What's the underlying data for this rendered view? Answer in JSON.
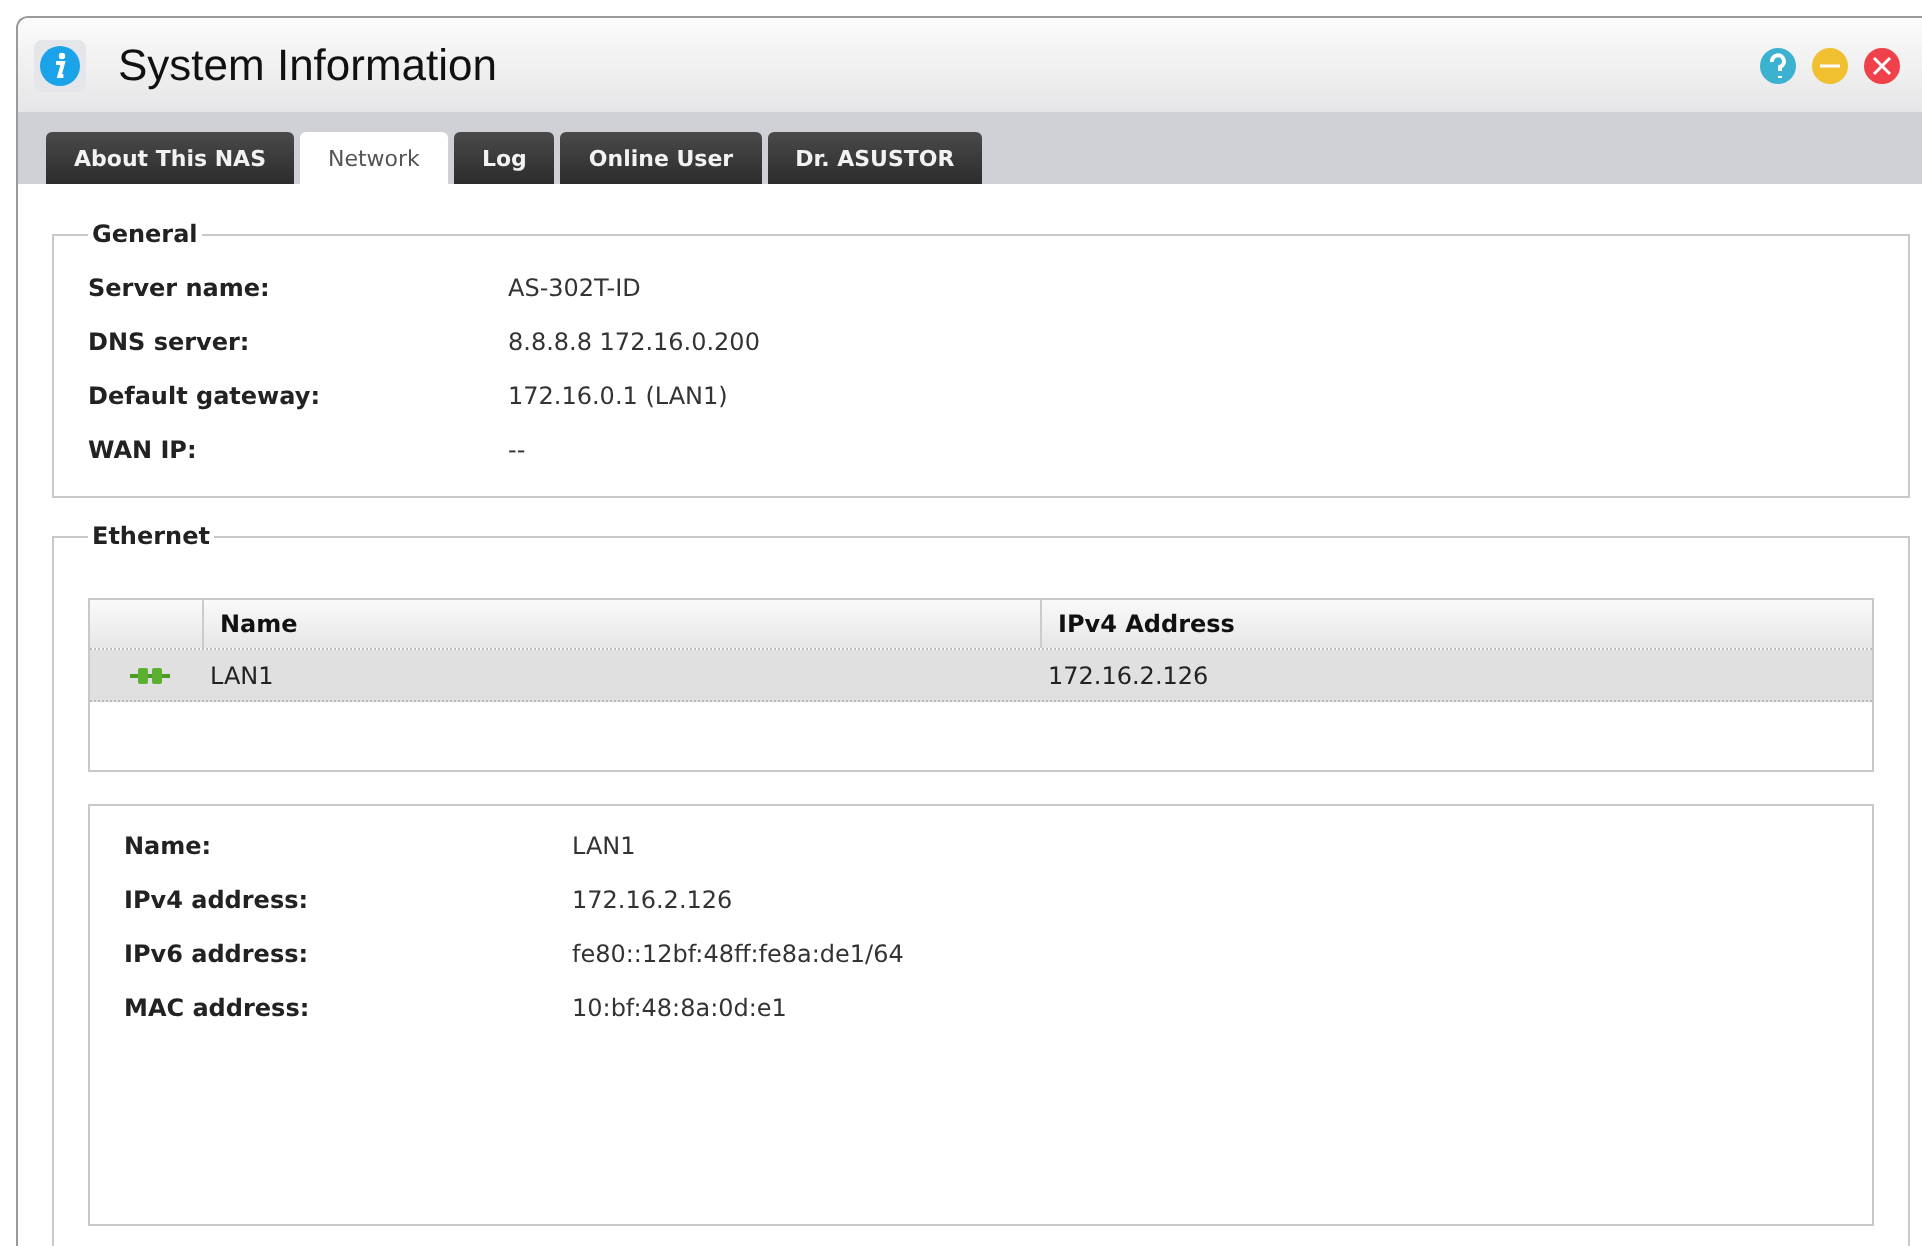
{
  "window": {
    "title": "System Information"
  },
  "tabs": [
    {
      "label": "About This NAS",
      "selected": false
    },
    {
      "label": "Network",
      "selected": true
    },
    {
      "label": "Log",
      "selected": false
    },
    {
      "label": "Online User",
      "selected": false
    },
    {
      "label": "Dr. ASUSTOR",
      "selected": false
    }
  ],
  "general": {
    "title": "General",
    "fields": [
      {
        "label": "Server name:",
        "value": "AS-302T-ID"
      },
      {
        "label": "DNS server:",
        "value": "8.8.8.8 172.16.0.200"
      },
      {
        "label": "Default gateway:",
        "value": "172.16.0.1 (LAN1)"
      },
      {
        "label": "WAN IP:",
        "value": "--"
      }
    ]
  },
  "ethernet": {
    "title": "Ethernet",
    "table": {
      "columns": [
        "Name",
        "IPv4 Address"
      ],
      "rows": [
        {
          "name": "LAN1",
          "ipv4": "172.16.2.126",
          "selected": true
        }
      ]
    },
    "details": [
      {
        "label": "Name:",
        "value": "LAN1"
      },
      {
        "label": "IPv4 address:",
        "value": "172.16.2.126"
      },
      {
        "label": "IPv6 address:",
        "value": "fe80::12bf:48ff:fe8a:de1/64"
      },
      {
        "label": "MAC address:",
        "value": "10:bf:48:8a:0d:e1"
      }
    ]
  }
}
